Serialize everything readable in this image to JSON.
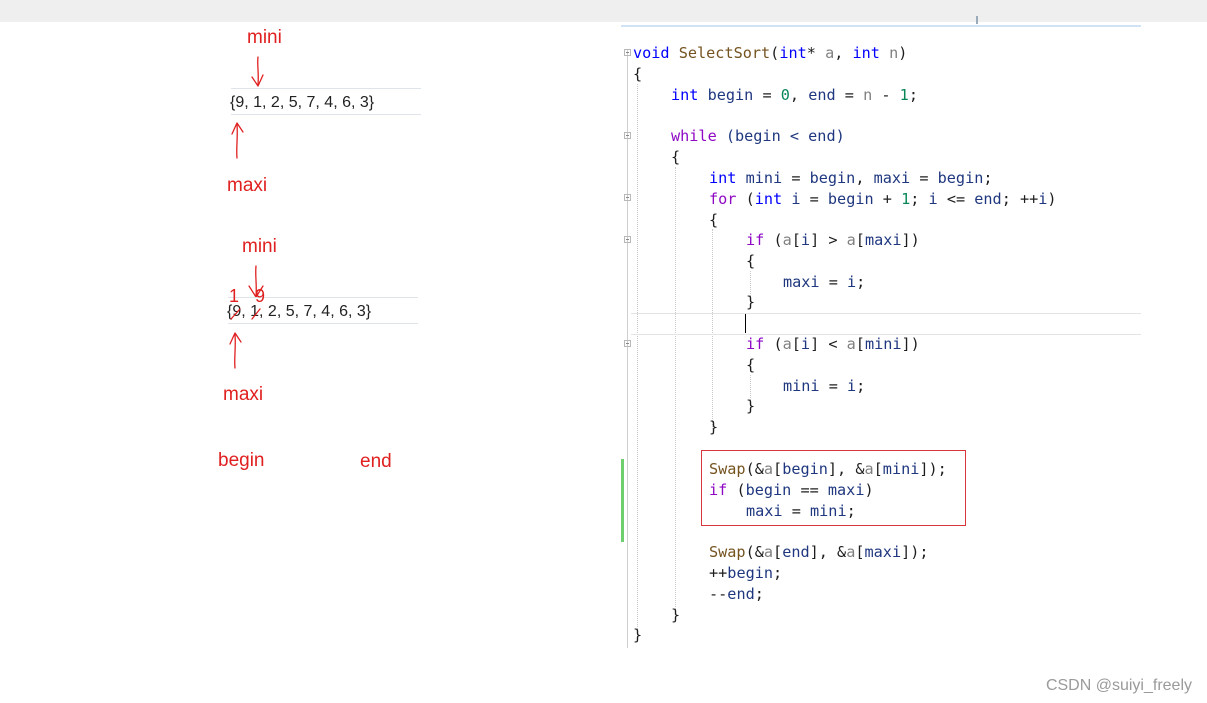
{
  "notes": {
    "first": {
      "mini": "mini",
      "array": "{9, 1, 2, 5, 7, 4, 6, 3}",
      "maxi": "maxi"
    },
    "second": {
      "mini": "mini",
      "swap_left": "1",
      "swap_right": "9",
      "array": "{9, 1, 2, 5, 7, 4, 6, 3}",
      "maxi": "maxi"
    },
    "begin": "begin",
    "end": "end"
  },
  "code": {
    "signature": {
      "kw": "void",
      "name": "SelectSort",
      "open": "(",
      "t1": "int",
      "star": "* ",
      "p1": "a",
      "comma": ", ",
      "t2": "int",
      "sp": " ",
      "p2": "n",
      "close": ")"
    },
    "brace_open": "{",
    "l3": {
      "kw": "int",
      "v1": "begin",
      "eq1": " = ",
      "n0": "0",
      "c": ", ",
      "v2": "end",
      "eq2": " = ",
      "p": "n",
      "rest": " - ",
      "n1": "1",
      "semi": ";"
    },
    "l5": {
      "kw": "while",
      "rest": " (begin < end)"
    },
    "l6": "{",
    "l7": {
      "kw": "int",
      "v1": "mini",
      "mid": " = ",
      "v2": "begin",
      "c": ", ",
      "v3": "maxi",
      "mid2": " = ",
      "v4": "begin",
      "semi": ";"
    },
    "l8": {
      "kw": "for",
      "o": " (",
      "t": "int",
      "v1": " i",
      "m1": " = ",
      "v2": "begin",
      "m2": " + ",
      "n": "1",
      "m3": "; ",
      "v3": "i",
      "m4": " <= ",
      "v4": "end",
      "m5": "; ++",
      "v5": "i",
      "cl": ")"
    },
    "l9": "{",
    "l10": {
      "kw": "if",
      "o": " (",
      "p1": "a",
      "b1": "[",
      "v1": "i",
      "b2": "] > ",
      "p2": "a",
      "b3": "[",
      "v2": "maxi",
      "b4": "])"
    },
    "l11": "{",
    "l12": {
      "v1": "maxi",
      "m": " = ",
      "v2": "i",
      "semi": ";"
    },
    "l13": "}",
    "l15": {
      "kw": "if",
      "o": " (",
      "p1": "a",
      "b1": "[",
      "v1": "i",
      "b2": "] < ",
      "p2": "a",
      "b3": "[",
      "v2": "mini",
      "b4": "])"
    },
    "l16": "{",
    "l17": {
      "v1": "mini",
      "m": " = ",
      "v2": "i",
      "semi": ";"
    },
    "l18": "}",
    "l19": "}",
    "l21": {
      "fn": "Swap",
      "o": "(&",
      "p1": "a",
      "b1": "[",
      "v1": "begin",
      "b2": "], &",
      "p2": "a",
      "b3": "[",
      "v2": "mini",
      "b4": "]);"
    },
    "l22": {
      "kw": "if",
      "o": " (",
      "v1": "begin",
      "m": " == ",
      "v2": "maxi",
      "c": ")"
    },
    "l23": {
      "v1": "maxi",
      "m": " = ",
      "v2": "mini",
      "semi": ";"
    },
    "l25": {
      "fn": "Swap",
      "o": "(&",
      "p1": "a",
      "b1": "[",
      "v1": "end",
      "b2": "], &",
      "p2": "a",
      "b3": "[",
      "v2": "maxi",
      "b4": "]);"
    },
    "l26": {
      "pre": "++",
      "v": "begin",
      "semi": ";"
    },
    "l27": {
      "pre": "--",
      "v": "end",
      "semi": ";"
    },
    "l28": "}",
    "l29": "}"
  },
  "watermark": "CSDN @suiyi_freely",
  "colors": {
    "annotation": "#e02020",
    "keyword": "#0000ff",
    "control": "#8f08c4",
    "function": "#74531f",
    "variable": "#1f377f",
    "parameter": "#808080",
    "number": "#098658",
    "highlight_box": "#d9363e",
    "change_bar": "#6fcf6f"
  }
}
